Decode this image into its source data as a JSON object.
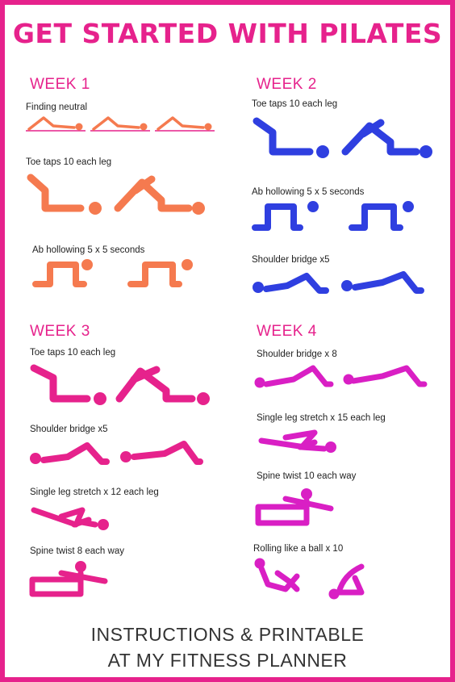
{
  "title": "GET STARTED WITH PILATES",
  "colors": {
    "border": "#e6228c",
    "title": "#e6228c",
    "week1_heading": "#e6228c",
    "week1_figure": "#f57a4f",
    "week1_line": "#e6228c",
    "week2_heading": "#e6228c",
    "week2_figure": "#2f3fe0",
    "week3_heading": "#e6228c",
    "week3_figure": "#e6228c",
    "week4_heading": "#e6228c",
    "week4_figure": "#d91fc4"
  },
  "weeks": [
    {
      "heading": "WEEK 1",
      "exercises": [
        {
          "label": "Finding neutral",
          "icon": "lying-knees-bent-icon"
        },
        {
          "label": "Toe taps 10 each leg",
          "icon": "toe-taps-icon"
        },
        {
          "label": "Ab hollowing 5 x 5 seconds",
          "icon": "all-fours-icon"
        }
      ]
    },
    {
      "heading": "WEEK 2",
      "exercises": [
        {
          "label": "Toe taps 10 each leg",
          "icon": "toe-taps-icon"
        },
        {
          "label": "Ab hollowing 5 x 5 seconds",
          "icon": "all-fours-icon"
        },
        {
          "label": "Shoulder bridge x5",
          "icon": "shoulder-bridge-icon"
        }
      ]
    },
    {
      "heading": "WEEK 3",
      "exercises": [
        {
          "label": "Toe taps 10 each leg",
          "icon": "toe-taps-icon"
        },
        {
          "label": "Shoulder bridge x5",
          "icon": "shoulder-bridge-icon"
        },
        {
          "label": "Single leg stretch x 12 each leg",
          "icon": "single-leg-stretch-icon"
        },
        {
          "label": "Spine twist 8 each way",
          "icon": "spine-twist-icon"
        }
      ]
    },
    {
      "heading": "WEEK 4",
      "exercises": [
        {
          "label": "Shoulder bridge x 8",
          "icon": "shoulder-bridge-icon"
        },
        {
          "label": "Single leg stretch x 15 each leg",
          "icon": "single-leg-stretch-icon"
        },
        {
          "label": "Spine twist 10 each way",
          "icon": "spine-twist-icon"
        },
        {
          "label": "Rolling like a ball x 10",
          "icon": "rolling-like-a-ball-icon"
        }
      ]
    }
  ],
  "footer": {
    "line1": "INSTRUCTIONS & PRINTABLE",
    "line2": "AT MY FITNESS PLANNER"
  }
}
